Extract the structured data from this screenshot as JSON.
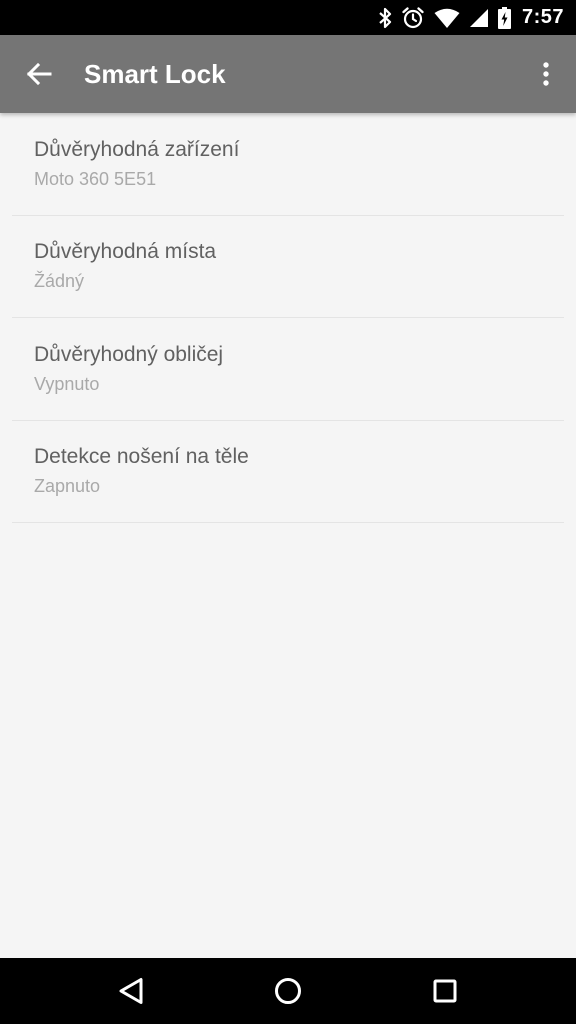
{
  "status_bar": {
    "time": "7:57",
    "icons": [
      "bluetooth-icon",
      "alarm-icon",
      "wifi-icon",
      "signal-icon",
      "battery-charging-icon"
    ]
  },
  "app_bar": {
    "title": "Smart Lock",
    "back_icon": "arrow-back-icon",
    "overflow_icon": "more-vertical-icon"
  },
  "settings": [
    {
      "title": "Důvěryhodná zařízení",
      "summary": "Moto 360 5E51"
    },
    {
      "title": "Důvěryhodná místa",
      "summary": "Žádný"
    },
    {
      "title": "Důvěryhodný obličej",
      "summary": "Vypnuto"
    },
    {
      "title": "Detekce nošení na těle",
      "summary": "Zapnuto"
    }
  ],
  "nav_bar": {
    "icons": [
      "nav-back-icon",
      "nav-home-icon",
      "nav-recents-icon"
    ]
  },
  "colors": {
    "app_bar": "#757575",
    "background": "#f5f5f5",
    "title_text": "#616161",
    "summary_text": "#a9a9a9"
  }
}
